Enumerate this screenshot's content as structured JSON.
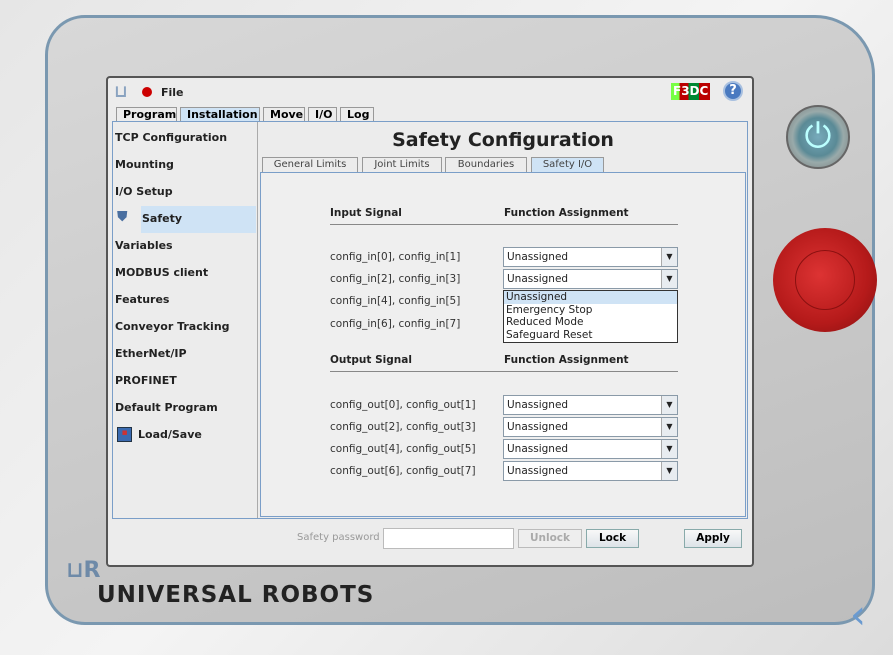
{
  "menu": {
    "file": "File",
    "status_badge": "F3DC"
  },
  "main_tabs": [
    "Program",
    "Installation",
    "Move",
    "I/O",
    "Log"
  ],
  "sidebar": [
    "TCP Configuration",
    "Mounting",
    "I/O Setup",
    "Safety",
    "Variables",
    "MODBUS client",
    "Features",
    "Conveyor Tracking",
    "EtherNet/IP",
    "PROFINET",
    "Default Program",
    "Load/Save"
  ],
  "title": "Safety Configuration",
  "sub_tabs": [
    "General Limits",
    "Joint Limits",
    "Boundaries",
    "Safety I/O"
  ],
  "inputs": {
    "header_signal": "Input Signal",
    "header_function": "Function Assignment",
    "rows": [
      {
        "signal": "config_in[0], config_in[1]",
        "value": "Unassigned"
      },
      {
        "signal": "config_in[2], config_in[3]",
        "value": "Unassigned"
      },
      {
        "signal": "config_in[4], config_in[5]"
      },
      {
        "signal": "config_in[6], config_in[7]"
      }
    ]
  },
  "dropdown_options": [
    "Unassigned",
    "Emergency Stop",
    "Reduced Mode",
    "Safeguard Reset"
  ],
  "outputs": {
    "header_signal": "Output Signal",
    "header_function": "Function Assignment",
    "rows": [
      {
        "signal": "config_out[0], config_out[1]",
        "value": "Unassigned"
      },
      {
        "signal": "config_out[2], config_out[3]",
        "value": "Unassigned"
      },
      {
        "signal": "config_out[4], config_out[5]",
        "value": "Unassigned"
      },
      {
        "signal": "config_out[6], config_out[7]",
        "value": "Unassigned"
      }
    ]
  },
  "footer": {
    "password_label": "Safety password",
    "password_value": "",
    "unlock": "Unlock",
    "lock": "Lock",
    "apply": "Apply"
  },
  "brand": "UNIVERSAL ROBOTS",
  "colors": {
    "selected": "#cfe3f5",
    "accent": "#6a9ad0",
    "estop": "#c0201e"
  }
}
